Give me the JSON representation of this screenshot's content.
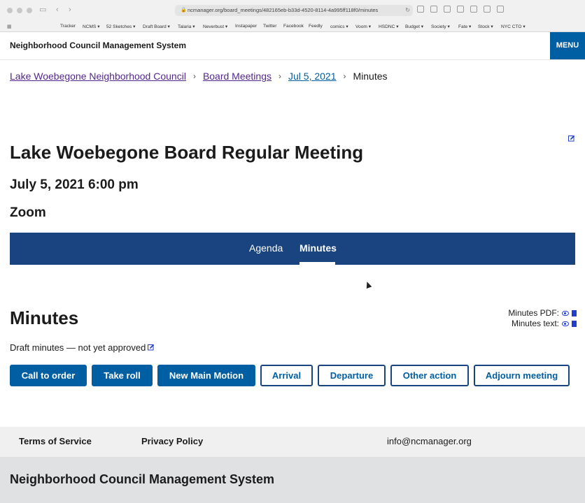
{
  "browser": {
    "url": "ncmanager.org/board_meetings/482165eb-b33d-4520-8114-4a995ff118f0/minutes",
    "bookmarks": [
      {
        "label": "Tracker"
      },
      {
        "label": "NCMS ▾"
      },
      {
        "label": "52 Sketches ▾"
      },
      {
        "label": "Draft Board ▾"
      },
      {
        "label": "Talaria ▾"
      },
      {
        "label": "Neverbust ▾"
      },
      {
        "label": "Instapaper"
      },
      {
        "label": "Twitter"
      },
      {
        "label": "Facebook"
      },
      {
        "label": "Feedly"
      },
      {
        "label": "comics ▾"
      },
      {
        "label": "Voom ▾"
      },
      {
        "label": "HSDNC ▾"
      },
      {
        "label": "Budget ▾"
      },
      {
        "label": "Society ▾"
      },
      {
        "label": "Fate ▾"
      },
      {
        "label": "Stock ▾"
      },
      {
        "label": "NYC CTO ▾"
      }
    ]
  },
  "header": {
    "site_title": "Neighborhood Council Management System",
    "menu_label": "MENU"
  },
  "breadcrumb": {
    "council": "Lake Woebegone Neighborhood Council",
    "meetings": "Board Meetings",
    "date": "Jul 5, 2021",
    "current": "Minutes"
  },
  "meeting": {
    "title": "Lake Woebegone Board Regular Meeting",
    "datetime": "July 5, 2021 6:00 pm",
    "location": "Zoom"
  },
  "tabs": [
    {
      "label": "Agenda",
      "active": false
    },
    {
      "label": "Minutes",
      "active": true
    }
  ],
  "minutes": {
    "heading": "Minutes",
    "pdf_label": "Minutes PDF:",
    "text_label": "Minutes text:",
    "status": "Draft minutes — not yet approved"
  },
  "actions": [
    {
      "label": "Call to order",
      "style": "solid"
    },
    {
      "label": "Take roll",
      "style": "solid"
    },
    {
      "label": "New Main Motion",
      "style": "solid"
    },
    {
      "label": "Arrival",
      "style": "outline"
    },
    {
      "label": "Departure",
      "style": "outline"
    },
    {
      "label": "Other action",
      "style": "outline"
    },
    {
      "label": "Adjourn meeting",
      "style": "outline"
    }
  ],
  "footer": {
    "terms": "Terms of Service",
    "privacy": "Privacy Policy",
    "email": "info@ncmanager.org",
    "name": "Neighborhood Council Management System"
  },
  "colors": {
    "primary": "#005ea2",
    "tab_bar": "#1a4480",
    "visited_link": "#54278f"
  }
}
